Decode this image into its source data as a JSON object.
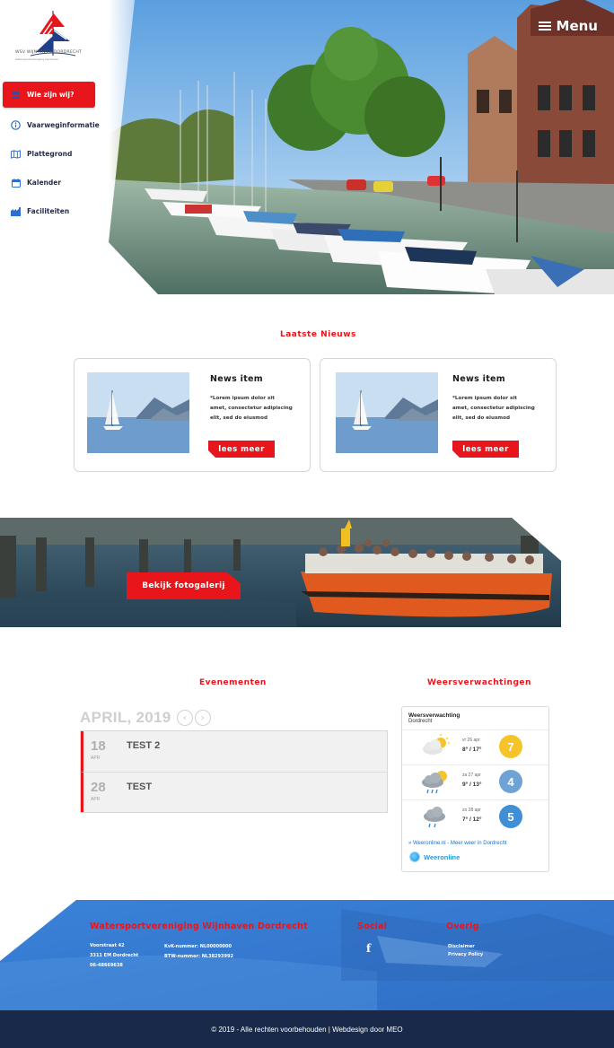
{
  "brand": {
    "logo_name": "WSV WIJNHAVEN DORDRECHT",
    "logo_sub": "watersportvereniging wijnhaven"
  },
  "sidebar": {
    "items": [
      {
        "label": "Wie zijn wij?",
        "icon": "users-icon",
        "active": true
      },
      {
        "label": "Vaarweginformatie",
        "icon": "info-icon",
        "active": false
      },
      {
        "label": "Plattegrond",
        "icon": "map-icon",
        "active": false
      },
      {
        "label": "Kalender",
        "icon": "calendar-icon",
        "active": false
      },
      {
        "label": "Faciliteiten",
        "icon": "facilities-icon",
        "active": false
      }
    ]
  },
  "header": {
    "menu_label": "Menu"
  },
  "news": {
    "title": "Laatste Nieuws",
    "items": [
      {
        "title": "News item",
        "excerpt": "*Lorem ipsum dolor sit amet, consectetur adipiscing elit, sed do eiusmod",
        "button": "lees meer"
      },
      {
        "title": "News item",
        "excerpt": "*Lorem ipsum dolor sit amet, consectetur adipiscing elit, sed do eiusmod",
        "button": "lees meer"
      }
    ]
  },
  "gallery": {
    "button": "Bekijk fotogalerij"
  },
  "events": {
    "title": "Evenementen",
    "month": "APRIL, 2019",
    "prev": "‹",
    "next": "›",
    "items": [
      {
        "day": "18",
        "month": "APR",
        "name": "TEST 2"
      },
      {
        "day": "28",
        "month": "APR",
        "name": "TEST"
      }
    ]
  },
  "weather": {
    "title": "Weersverwachtingen",
    "widget_title": "Weersverwachting",
    "city": "Dordrecht",
    "days": [
      {
        "date": "vr 26 apr",
        "temp": "8° / 17°",
        "score": "7",
        "color": "#f6c429",
        "icon": "partly-cloudy-icon"
      },
      {
        "date": "za 27 apr",
        "temp": "9° / 13°",
        "score": "4",
        "color": "#6fa3d6",
        "icon": "sun-rain-icon"
      },
      {
        "date": "zo 28 apr",
        "temp": "7° / 12°",
        "score": "5",
        "color": "#3f8fd6",
        "icon": "rain-icon"
      }
    ],
    "link": "» Weeronline.nl - Meer weer in Dordrecht",
    "logo": "Weeronline"
  },
  "footer": {
    "club_title": "Watersportvereniging Wijnhaven Dordrecht",
    "address": [
      "Voorstraat 42",
      "3311 EM Dordrecht",
      "06-48669638"
    ],
    "registration": [
      "KvK-nummer: NL00000000",
      "BTW-nummer: NL38293992"
    ],
    "social_title": "Social",
    "other_title": "Overig",
    "other_links": [
      "Disclaimer",
      "Privacy Policy"
    ],
    "copyright": "© 2019 - Alle rechten voorbehouden | Webdesign door MEO"
  },
  "colors": {
    "accent": "#e8151b",
    "navy": "#18294a",
    "footer_blue": "#3a7fd5"
  }
}
